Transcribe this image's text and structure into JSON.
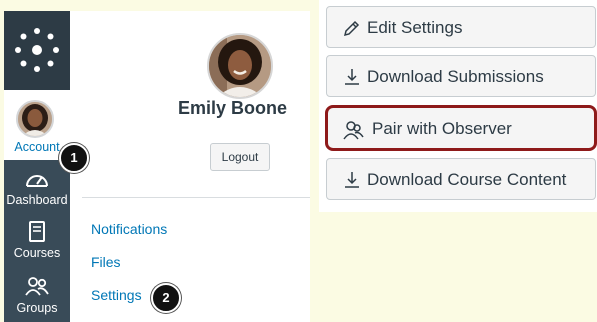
{
  "global_nav": {
    "account_label": "Account",
    "items": [
      {
        "label": "Dashboard",
        "icon": "dashboard-icon"
      },
      {
        "label": "Courses",
        "icon": "courses-icon"
      },
      {
        "label": "Groups",
        "icon": "groups-icon"
      }
    ]
  },
  "tray": {
    "user_name": "Emily Boone",
    "logout_label": "Logout",
    "links": [
      "Notifications",
      "Files",
      "Settings"
    ]
  },
  "callouts": [
    "1",
    "2"
  ],
  "settings_sidebar": {
    "buttons": [
      {
        "label": "Edit Settings",
        "icon": "pencil-icon"
      },
      {
        "label": "Download Submissions",
        "icon": "download-icon"
      },
      {
        "label": "Pair with Observer",
        "icon": "observer-icon",
        "highlighted": true
      },
      {
        "label": "Download Course Content",
        "icon": "download-icon"
      }
    ]
  },
  "colors": {
    "nav_background": "#394b58",
    "link_blue": "#0077b6",
    "highlight_border": "#8e1a1a",
    "page_background": "#fbfbe3"
  }
}
